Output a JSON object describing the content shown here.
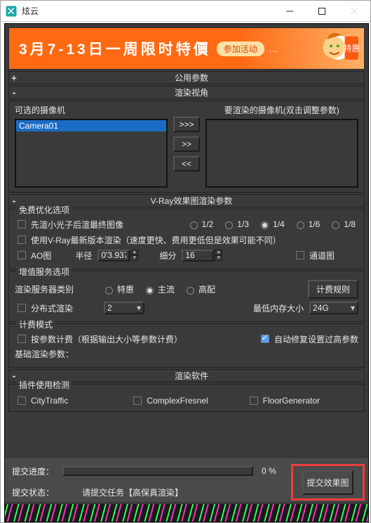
{
  "window": {
    "title": "炫云"
  },
  "banner": {
    "main": "3月7-13日一周限时特價",
    "pill": "参加活动",
    "dots": "…"
  },
  "sections": {
    "public_params": "公用参数",
    "render_view": "渲染视角",
    "vray_params": "V-Ray效果图渲染参数",
    "render_soft": "渲染软件"
  },
  "camera": {
    "selectable": "可选的摄像机",
    "to_render": "要渲染的摄像机(双击调整参数)",
    "selected": "Camera01",
    "btn_all": ">>>",
    "btn_add": ">>",
    "btn_remove": "<<"
  },
  "opt": {
    "legend_free": "免费优化选项",
    "pre_light": "先渲小光子后渲最终图像",
    "use_latest": "使用V-Ray最新版本渲染（速度更快、费用更低但是效果可能不同）",
    "ao": "AO图",
    "radius_label": "半径",
    "radius": "0'3.937\"",
    "subdiv_label": "细分",
    "subdiv": "16",
    "channel": "通道图",
    "scales": {
      "s2": "1/2",
      "s3": "1/3",
      "s4": "1/4",
      "s6": "1/6",
      "s8": "1/8"
    }
  },
  "value_add": {
    "legend": "增值服务选项",
    "server_type": "渲染服务器类别",
    "r1": "特惠",
    "r2": "主流",
    "r3": "高配",
    "billing_rules": "计费规则",
    "distributed": "分布式渲染",
    "dist_count": "2",
    "min_mem_label": "最低内存大小",
    "min_mem": "24G"
  },
  "billing": {
    "legend": "计费模式",
    "per_param": "按参数计费（根据输出大小等参数计费）",
    "auto_fix": "自动修复设置过高参数",
    "base_params": "基础渲染参数："
  },
  "plugins": {
    "legend": "插件使用检测",
    "p1": "CityTraffic",
    "p2": "ComplexFresnel",
    "p3": "FloorGenerator"
  },
  "footer": {
    "progress_label": "提交进度：",
    "percent": "0 %",
    "status_label": "提交状态：",
    "status_value": "请提交任务【高保真渲染】",
    "submit": "提交效果图"
  }
}
